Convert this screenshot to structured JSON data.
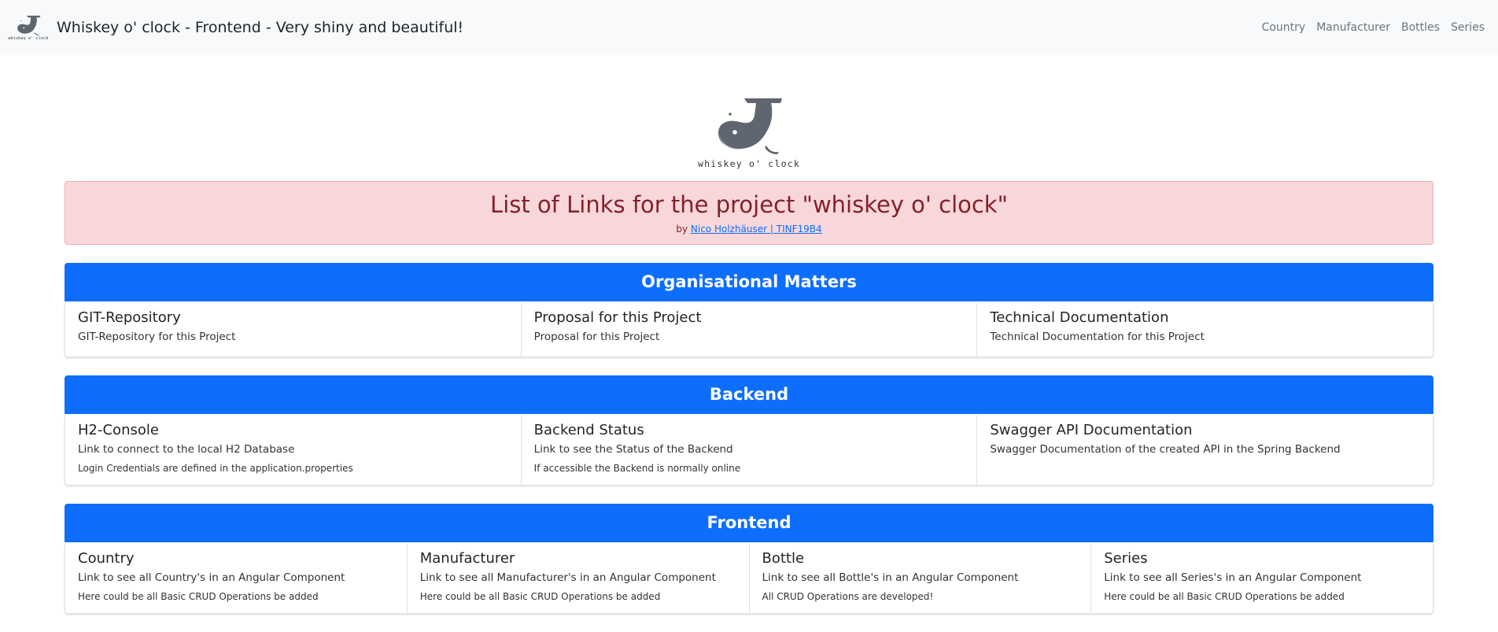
{
  "navbar": {
    "logo_text": "whiskey o' clock",
    "title": "Whiskey o' clock - Frontend - Very shiny and beautiful!",
    "links": [
      "Country",
      "Manufacturer",
      "Bottles",
      "Series"
    ]
  },
  "hero": {
    "logo_text": "whiskey o' clock"
  },
  "alert": {
    "title": "List of Links for the project \"whiskey o' clock\"",
    "by": "by",
    "author_link": "Nico Holzhäuser | TINF19B4"
  },
  "sections": [
    {
      "title": "Organisational Matters",
      "cards": [
        {
          "title": "GIT-Repository",
          "text": "GIT-Repository for this Project",
          "note": ""
        },
        {
          "title": "Proposal for this Project",
          "text": "Proposal for this Project",
          "note": ""
        },
        {
          "title": "Technical Documentation",
          "text": "Technical Documentation for this Project",
          "note": ""
        }
      ]
    },
    {
      "title": "Backend",
      "cards": [
        {
          "title": "H2-Console",
          "text": "Link to connect to the local H2 Database",
          "note": "Login Credentials are defined in the application.properties"
        },
        {
          "title": "Backend Status",
          "text": "Link to see the Status of the Backend",
          "note": "If accessible the Backend is normally online"
        },
        {
          "title": "Swagger API Documentation",
          "text": "Swagger Documentation of the created API in the Spring Backend",
          "note": ""
        }
      ]
    },
    {
      "title": "Frontend",
      "cards": [
        {
          "title": "Country",
          "text": "Link to see all Country's in an Angular Component",
          "note": "Here could be all Basic CRUD Operations be added"
        },
        {
          "title": "Manufacturer",
          "text": "Link to see all Manufacturer's in an Angular Component",
          "note": "Here could be all Basic CRUD Operations be added"
        },
        {
          "title": "Bottle",
          "text": "Link to see all Bottle's in an Angular Component",
          "note": "All CRUD Operations are developed!"
        },
        {
          "title": "Series",
          "text": "Link to see all Series's in an Angular Component",
          "note": "Here could be all Basic CRUD Operations be added"
        }
      ]
    }
  ],
  "colors": {
    "primary": "#0d6efd",
    "alert_bg": "#f8d7da",
    "alert_text": "#842029",
    "navbar_bg": "#f8f9fa",
    "whale": "#5f6670"
  }
}
